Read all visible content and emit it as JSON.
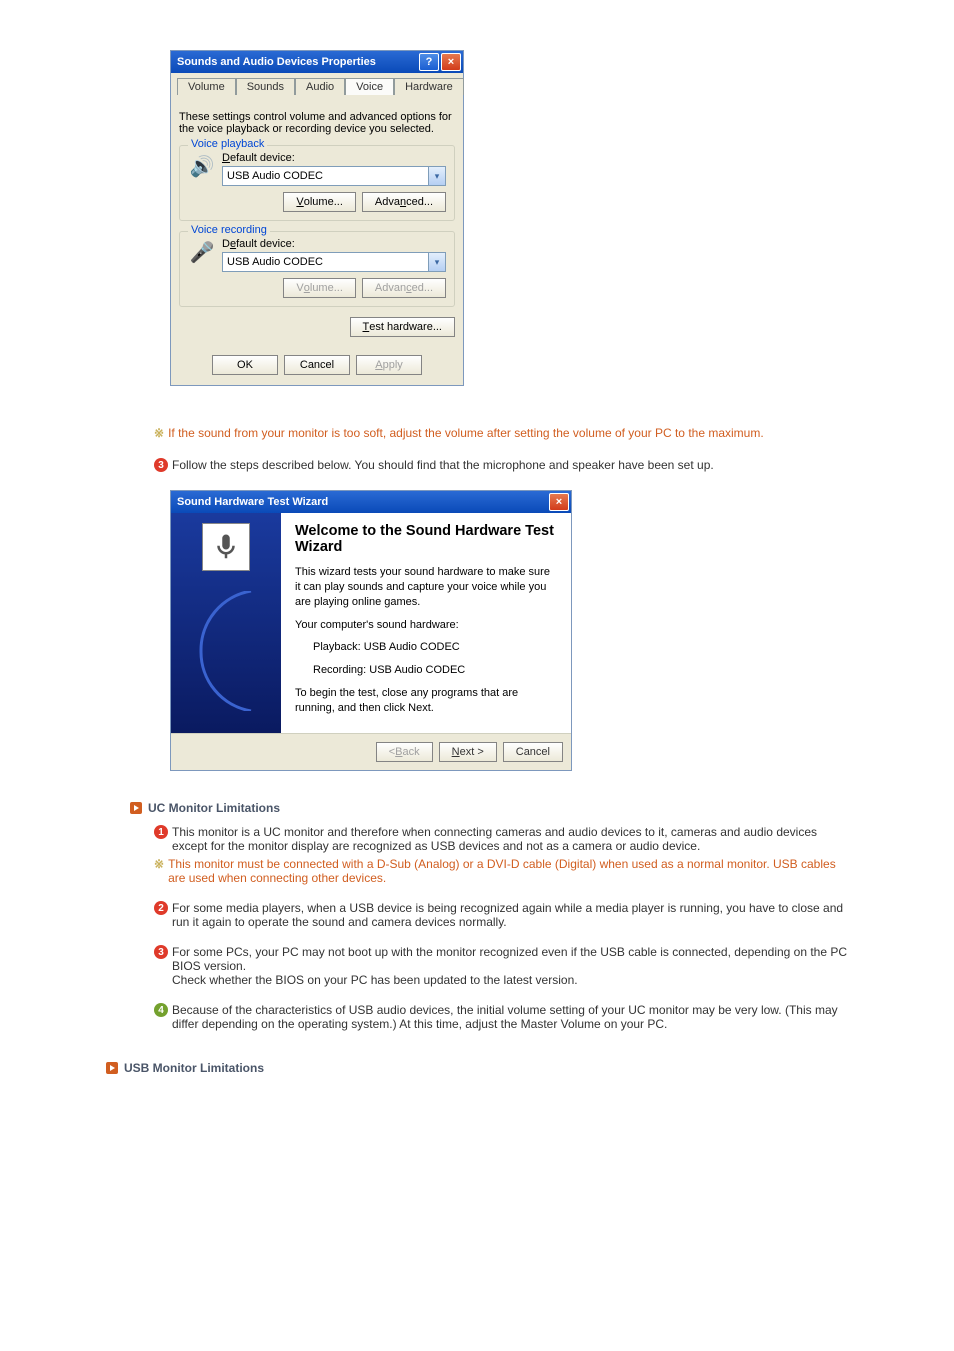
{
  "dlg1": {
    "title": "Sounds and Audio Devices Properties",
    "help_glyph": "?",
    "close_glyph": "×",
    "tabs": [
      "Volume",
      "Sounds",
      "Audio",
      "Voice",
      "Hardware"
    ],
    "description": "These settings control volume and advanced options for the voice playback or recording device you selected.",
    "group_playback": {
      "legend": "Voice playback",
      "label": "Default device:",
      "value": "USB Audio CODEC",
      "btn_volume": "Volume...",
      "btn_advanced": "Advanced...",
      "icon": "🔊"
    },
    "group_recording": {
      "legend": "Voice recording",
      "label": "Default device:",
      "value": "USB Audio CODEC",
      "btn_volume": "Volume...",
      "btn_advanced": "Advanced...",
      "icon": "🎤"
    },
    "btn_test": "Test hardware...",
    "btn_ok": "OK",
    "btn_cancel": "Cancel",
    "btn_apply": "Apply"
  },
  "notes": {
    "star_glyph": "※",
    "soft_sound": "If the sound from your monitor is too soft, adjust the volume after setting the volume of your PC to the maximum.",
    "step3_num": "3",
    "step3": "Follow the steps described below. You should find that the microphone and speaker have been set up."
  },
  "wizard": {
    "title": "Sound Hardware Test Wizard",
    "close_glyph": "×",
    "heading": "Welcome to the Sound Hardware Test Wizard",
    "p1": "This wizard tests your sound hardware to make sure it can play sounds and capture your voice while you are playing online games.",
    "p2": "Your computer's sound hardware:",
    "playback": "Playback:  USB Audio CODEC",
    "recording": "Recording:  USB Audio CODEC",
    "p3": "To begin the test, close any programs that are running, and then click Next.",
    "btn_back": "< Back",
    "btn_next": "Next >",
    "btn_cancel": "Cancel"
  },
  "uc": {
    "heading": "UC Monitor Limitations",
    "n1": "1",
    "t1": "This monitor is a UC monitor and therefore when connecting cameras and audio devices to it, cameras and audio devices except for the monitor display are recognized as USB devices and not as a camera or audio device.",
    "star": "This monitor must be connected with a D-Sub (Analog) or a DVI-D cable (Digital) when used as a normal monitor. USB cables are used when connecting other devices.",
    "n2": "2",
    "t2": "For some media players, when a USB device is being recognized again while a media player is running, you have to close and run it again to operate the sound and camera devices normally.",
    "n3": "3",
    "t3a": "For some PCs, your PC may not boot up with the monitor recognized even if the USB cable is connected, depending on the PC BIOS version.",
    "t3b": "Check whether the BIOS on your PC has been updated to the latest version.",
    "n4": "4",
    "t4": "Because of the characteristics of USB audio devices, the initial volume setting of your UC monitor may be very low. (This may differ depending on the operating system.) At this time, adjust the Master Volume on your PC."
  },
  "usb": {
    "heading": "USB Monitor Limitations"
  }
}
